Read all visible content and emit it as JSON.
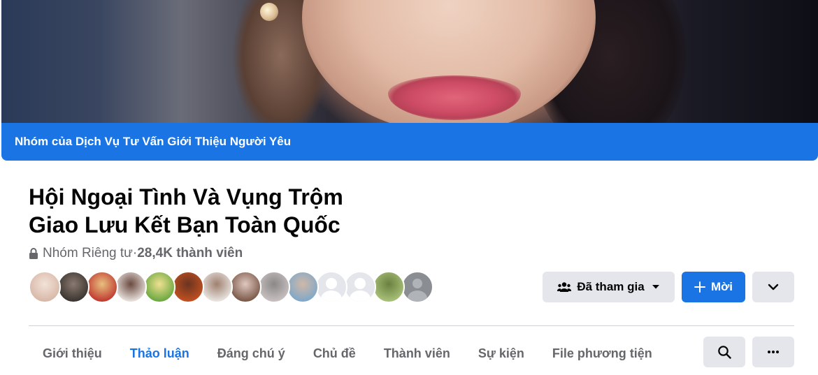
{
  "cover": {
    "banner_text": "Nhóm của Dịch Vụ Tư Vấn Giới Thiệu Người Yêu",
    "banner_color": "#1b74e4"
  },
  "group": {
    "name_line1": "Hội Ngoại Tình Và Vụng Trộm",
    "name_line2": "Giao Lưu Kết Bạn Toàn Quốc",
    "privacy": "Nhóm Riêng tư",
    "separator": " · ",
    "members": "28,4K thành viên"
  },
  "member_avatars": [
    {
      "kind": "photo",
      "colors": [
        "#d8b8a8",
        "#f2e2d8"
      ]
    },
    {
      "kind": "photo",
      "colors": [
        "#3a3430",
        "#8a7a70"
      ]
    },
    {
      "kind": "photo",
      "colors": [
        "#c03a30",
        "#e8c080"
      ]
    },
    {
      "kind": "photo",
      "colors": [
        "#e8e0dc",
        "#6a4a40"
      ]
    },
    {
      "kind": "photo",
      "colors": [
        "#6aa840",
        "#f0e090"
      ]
    },
    {
      "kind": "photo",
      "colors": [
        "#c05020",
        "#6a3420"
      ]
    },
    {
      "kind": "photo",
      "colors": [
        "#e8e4e0",
        "#a08070"
      ]
    },
    {
      "kind": "photo",
      "colors": [
        "#7a5848",
        "#e0c8c0"
      ]
    },
    {
      "kind": "photo",
      "colors": [
        "#c8c0c0",
        "#8a8888"
      ]
    },
    {
      "kind": "photo",
      "colors": [
        "#80a8c8",
        "#d0b8a8"
      ]
    },
    {
      "kind": "blank"
    },
    {
      "kind": "blank"
    },
    {
      "kind": "photo",
      "colors": [
        "#a8c078",
        "#6a8040"
      ]
    },
    {
      "kind": "gray"
    }
  ],
  "actions": {
    "joined_label": "Đã tham gia",
    "joined_icon": "group-members-icon",
    "invite_label": "Mời",
    "invite_icon": "plus-icon",
    "more_icon": "chevron-down-icon"
  },
  "tabs": [
    {
      "label": "Giới thiệu",
      "active": false
    },
    {
      "label": "Thảo luận",
      "active": true
    },
    {
      "label": "Đáng chú ý",
      "active": false
    },
    {
      "label": "Chủ đề",
      "active": false
    },
    {
      "label": "Thành viên",
      "active": false
    },
    {
      "label": "Sự kiện",
      "active": false
    },
    {
      "label": "File phương tiện",
      "active": false
    }
  ],
  "toolbar": {
    "search_icon": "search-icon",
    "more_icon": "more-dots-icon"
  },
  "colors": {
    "accent": "#1b74e4",
    "secondary_text": "#65676b",
    "button_gray": "#e4e6eb"
  }
}
